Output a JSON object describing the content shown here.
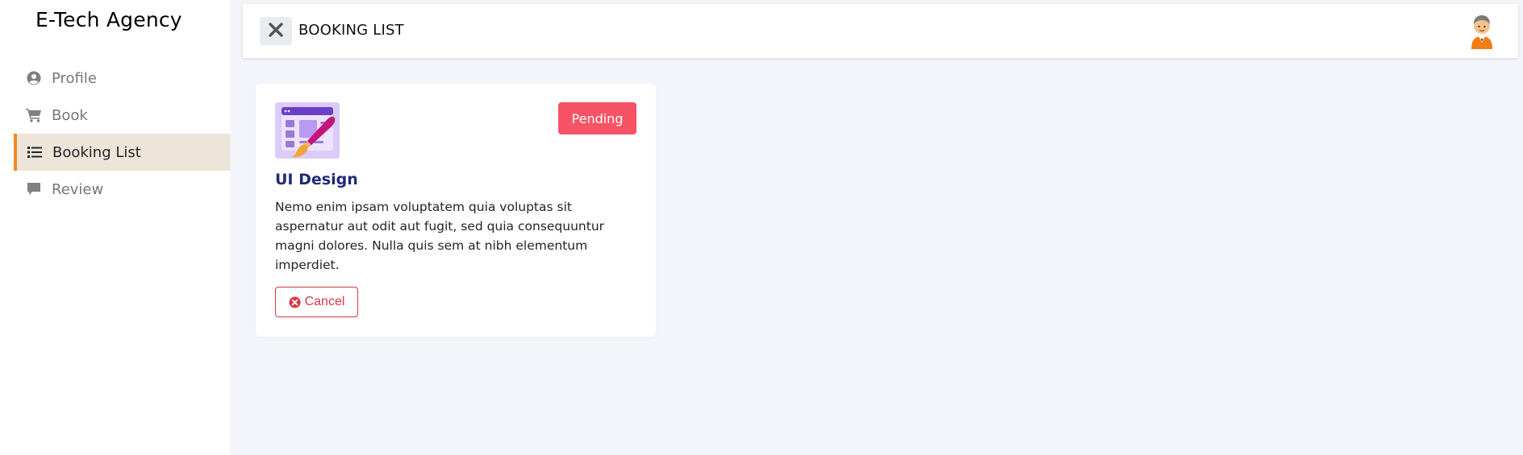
{
  "app": {
    "brand": "E-Tech Agency"
  },
  "sidebar": {
    "items": [
      {
        "label": "Profile",
        "icon": "user-circle-icon",
        "active": false
      },
      {
        "label": "Book",
        "icon": "cart-icon",
        "active": false
      },
      {
        "label": "Booking List",
        "icon": "list-icon",
        "active": true
      },
      {
        "label": "Review",
        "icon": "comment-icon",
        "active": false
      }
    ]
  },
  "header": {
    "title": "BOOKING LIST",
    "close_icon": "close-icon",
    "avatar_icon": "user-avatar"
  },
  "booking": {
    "title": "UI Design",
    "status": "Pending",
    "description": "Nemo enim ipsam voluptatem quia voluptas sit aspernatur aut odit aut fugit, sed quia consequuntur magni dolores. Nulla quis sem at nibh elementum imperdiet.",
    "cancel_label": "Cancel",
    "thumbnail_icon": "ui-design-illustration"
  },
  "colors": {
    "accent": "#f08a24",
    "active_bg": "#ede4da",
    "pending": "#f65366",
    "danger": "#dc3545",
    "title": "#1e2a78",
    "background": "#f3f5fa"
  }
}
